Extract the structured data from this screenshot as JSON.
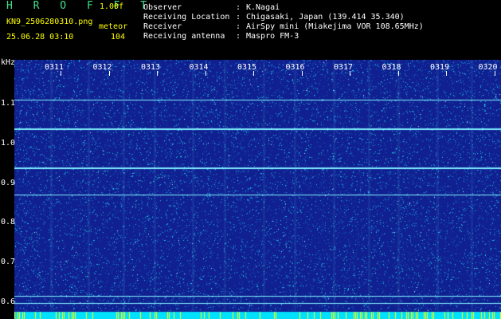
{
  "header": {
    "brand": "H R O F F T",
    "version": "1.00f",
    "filename": "KN9_2506280310.png",
    "datetime": "25.06.28 03:10",
    "mode_label": "meteor",
    "count": "104"
  },
  "info": [
    {
      "label": "Observer",
      "sep": ":",
      "value": "K.Nagai"
    },
    {
      "label": "Receiving Location",
      "sep": ":",
      "value": "Chigasaki, Japan (139.414 35.340)"
    },
    {
      "label": "Receiver",
      "sep": ":",
      "value": "AirSpy mini (Miakejima VOR 108.65MHz)"
    },
    {
      "label": "Receiving antenna",
      "sep": ":",
      "value": "Maspro FM-3"
    }
  ],
  "plot": {
    "y_unit": "kHz",
    "y_ticks": [
      "1.1",
      "1.0",
      "0.9",
      "0.8",
      "0.7",
      "0.6"
    ],
    "x_ticks": [
      "0311",
      "0312",
      "0313",
      "0314",
      "0315",
      "0316",
      "0317",
      "0318",
      "0319",
      "0320"
    ],
    "colors": {
      "background": "#102090",
      "speckle": "#1fc8e8",
      "carrier": "#7ff0ff",
      "bottom_bar": "#00e0ff",
      "bottom_yellow": "#ffff00"
    }
  }
}
